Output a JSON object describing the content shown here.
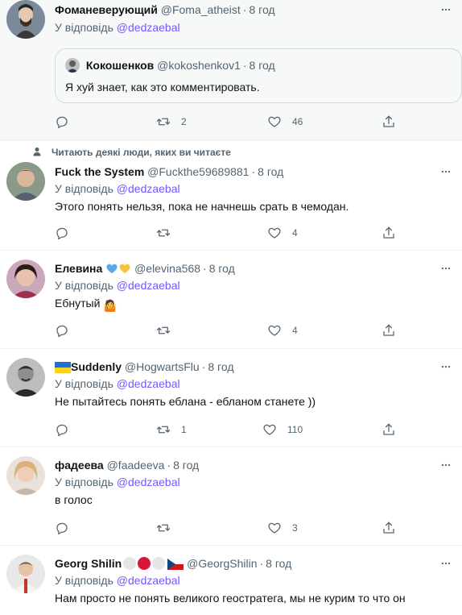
{
  "reply_prefix": "У відповідь",
  "reply_to": "@dedzaebal",
  "social_context": "Читають деякі люди, яких ви читаєте",
  "tweets": [
    {
      "name": "Фоманеверующий",
      "handle": "@Foma_atheist",
      "time": "8 год",
      "text": "",
      "quote": {
        "name": "Кокошенков",
        "handle": "@kokoshenkov1",
        "time": "8 год",
        "text": "Я хуй знает, как это комментировать."
      },
      "retweets": "2",
      "likes": "46"
    },
    {
      "name": "Fuck the System",
      "handle": "@Fuckthe59689881",
      "time": "8 год",
      "text": "Этого понять нельзя, пока не начнешь срать в чемодан.",
      "retweets": "",
      "likes": "4"
    },
    {
      "name": "Елевина",
      "handle": "@elevina568",
      "time": "8 год",
      "text": "Ебнутый",
      "text_emoji": "🤷",
      "retweets": "",
      "likes": "4"
    },
    {
      "name": "Suddenly",
      "handle": "@HogwartsFlu",
      "time": "8 год",
      "text": "Не пытайтесь понять еблана - ебланом станете ))",
      "retweets": "1",
      "likes": "110"
    },
    {
      "name": "фадеева",
      "handle": "@faadeeva",
      "time": "8 год",
      "text": "в голос",
      "retweets": "",
      "likes": "3"
    },
    {
      "name": "Georg Shilin",
      "handle": "@GeorgShilin",
      "time": "8 год",
      "text": "Нам просто не понять великого геостратега, мы не курим то что он",
      "retweets": "",
      "likes": ""
    }
  ],
  "colors": {
    "accent": "#7856ff",
    "secondary_text": "#536471",
    "divider": "#eff3f4"
  },
  "icons": [
    "reply-icon",
    "retweet-icon",
    "like-icon",
    "share-icon",
    "more-icon",
    "person-icon"
  ]
}
